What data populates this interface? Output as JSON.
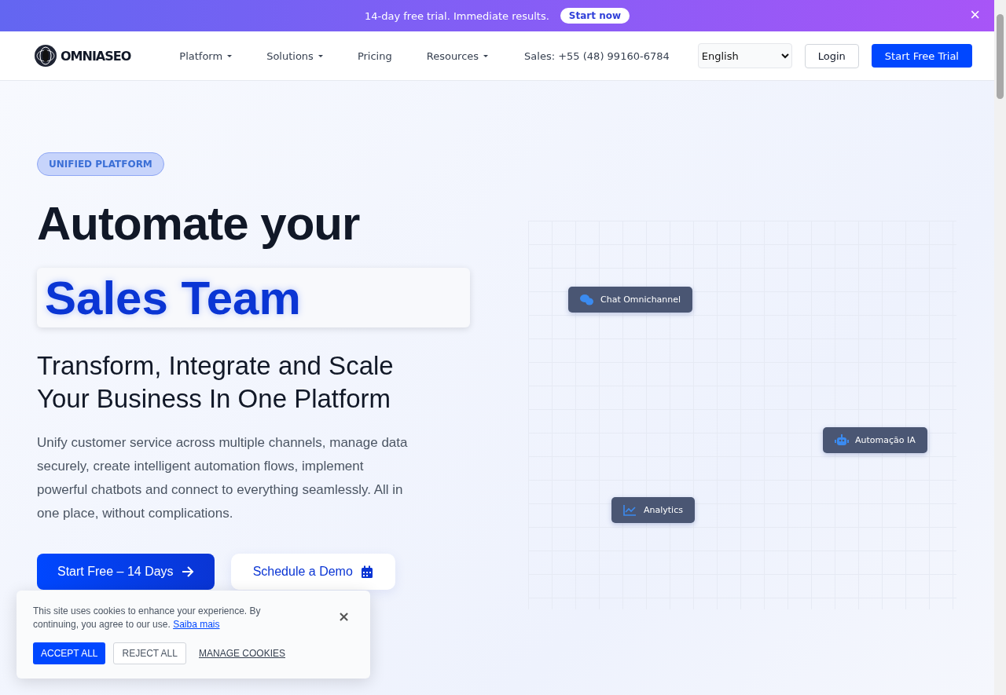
{
  "promo_bar": {
    "text": "14-day free trial. Immediate results.",
    "button": "Start now",
    "close": "×"
  },
  "nav": {
    "logo": "OMNIASEO",
    "links": [
      {
        "label": "Platform",
        "has_menu": true
      },
      {
        "label": "Solutions",
        "has_menu": true
      },
      {
        "label": "Pricing",
        "has_menu": false
      },
      {
        "label": "Resources",
        "has_menu": true
      }
    ],
    "phone": "Sales: +55 (48) 99160-6784",
    "language": "English",
    "login": "Login",
    "cta": "Start Free Trial"
  },
  "hero": {
    "badge": "UNIFIED PLATFORM",
    "title": "Automate your",
    "highlight": "Sales Team",
    "subtitle": "Transform, Integrate and Scale Your Business In One Platform",
    "description": "Unify customer service across multiple channels, manage data securely, create intelligent automation flows, implement powerful chatbots and connect to everything seamlessly. All in one place, without complications.",
    "primary_button": "Start Free – 14 Days",
    "secondary_button": "Schedule a Demo"
  },
  "feature_nodes": [
    {
      "label": "Chat Omnichannel",
      "kind": "chat"
    },
    {
      "label": "Automação IA",
      "kind": "robot"
    },
    {
      "label": "Analytics",
      "kind": "chart"
    }
  ],
  "cookie_banner": {
    "text": "This site uses cookies to enhance your experience. By continuing, you agree to our use.",
    "link": "Saiba mais",
    "close": "×",
    "accept": "ACCEPT ALL",
    "reject": "REJECT ALL",
    "manage": "MANAGE COOKIES"
  }
}
